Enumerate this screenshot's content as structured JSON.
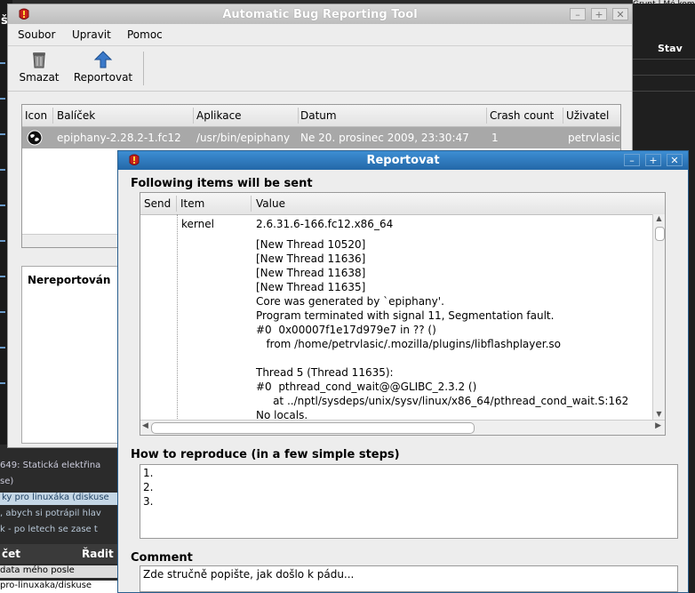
{
  "background": {
    "top_text": "Grunt | Mé komentáře | Navštívené disku",
    "right_header": "Stav",
    "left_letter": "š",
    "page_lines": [
      "649: Statická elektřina",
      "se)",
      "ky pro linuxáka (diskuse",
      ", abych si potrápil hlav",
      "k - po letech se zase t"
    ],
    "page_header_1": "čet",
    "page_header_2": "Řadit",
    "page_line_6": "data mého posle",
    "page_line_7": "pro-linuxaka/diskuse"
  },
  "main_window": {
    "title": "Automatic Bug Reporting Tool",
    "menu": [
      "Soubor",
      "Upravit",
      "Pomoc"
    ],
    "toolbar": {
      "delete_label": "Smazat",
      "report_label": "Reportovat"
    },
    "columns": [
      "Icon",
      "Balíček",
      "Aplikace",
      "Datum",
      "Crash count",
      "Uživatel"
    ],
    "rows": [
      {
        "package": "epiphany-2.28.2-1.fc12",
        "application": "/usr/bin/epiphany",
        "date": "Ne 20. prosinec 2009, 23:30:47",
        "crash_count": "1",
        "user": "petrvlasic"
      }
    ],
    "unreported_label": "Nereportován"
  },
  "dialog": {
    "title": "Reportovat",
    "items_label": "Following items will be sent",
    "columns": [
      "Send",
      "Item",
      "Value"
    ],
    "item_name": "kernel",
    "item_value": "2.6.31.6-166.fc12.x86_64",
    "backtrace_lines": [
      "[New Thread 10520]",
      "[New Thread 11636]",
      "[New Thread 11638]",
      "[New Thread 11635]",
      "Core was generated by `epiphany'.",
      "Program terminated with signal 11, Segmentation fault.",
      "#0  0x00007f1e17d979e7 in ?? ()",
      "   from /home/petrvlasic/.mozilla/plugins/libflashplayer.so",
      "",
      "Thread 5 (Thread 11635):",
      "#0  pthread_cond_wait@@GLIBC_2.3.2 ()",
      "     at ../nptl/sysdeps/unix/sysv/linux/x86_64/pthread_cond_wait.S:162",
      "No locals."
    ],
    "reproduce_label": "How to reproduce (in a few simple steps)",
    "reproduce_lines": [
      "1.",
      "2.",
      "3."
    ],
    "comment_label": "Comment",
    "comment_text": "Zde stručně popište, jak došlo k pádu..."
  }
}
